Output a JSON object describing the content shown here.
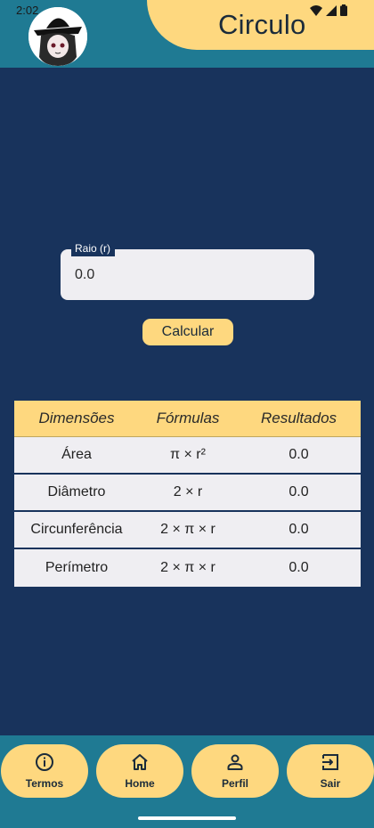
{
  "status_bar": {
    "time": "2:02"
  },
  "header": {
    "title": "Circulo"
  },
  "input": {
    "label": "Raio (r)",
    "value": "0.0"
  },
  "actions": {
    "calculate_label": "Calcular"
  },
  "table": {
    "headers": [
      "Dimensões",
      "Fórmulas",
      "Resultados"
    ],
    "rows": [
      {
        "dimension": "Área",
        "formula": "π × r²",
        "result": "0.0"
      },
      {
        "dimension": "Diâmetro",
        "formula": "2 × r",
        "result": "0.0"
      },
      {
        "dimension": "Circunferência",
        "formula": "2 × π × r",
        "result": "0.0"
      },
      {
        "dimension": "Perímetro",
        "formula": "2 × π × r",
        "result": "0.0"
      }
    ]
  },
  "nav": {
    "items": [
      {
        "label": "Termos",
        "icon": "info-icon"
      },
      {
        "label": "Home",
        "icon": "home-icon"
      },
      {
        "label": "Perfil",
        "icon": "person-icon"
      },
      {
        "label": "Sair",
        "icon": "logout-icon"
      }
    ]
  },
  "colors": {
    "background": "#18335c",
    "header": "#1f7a93",
    "accent": "#fed87f",
    "surface": "#efeef2"
  }
}
